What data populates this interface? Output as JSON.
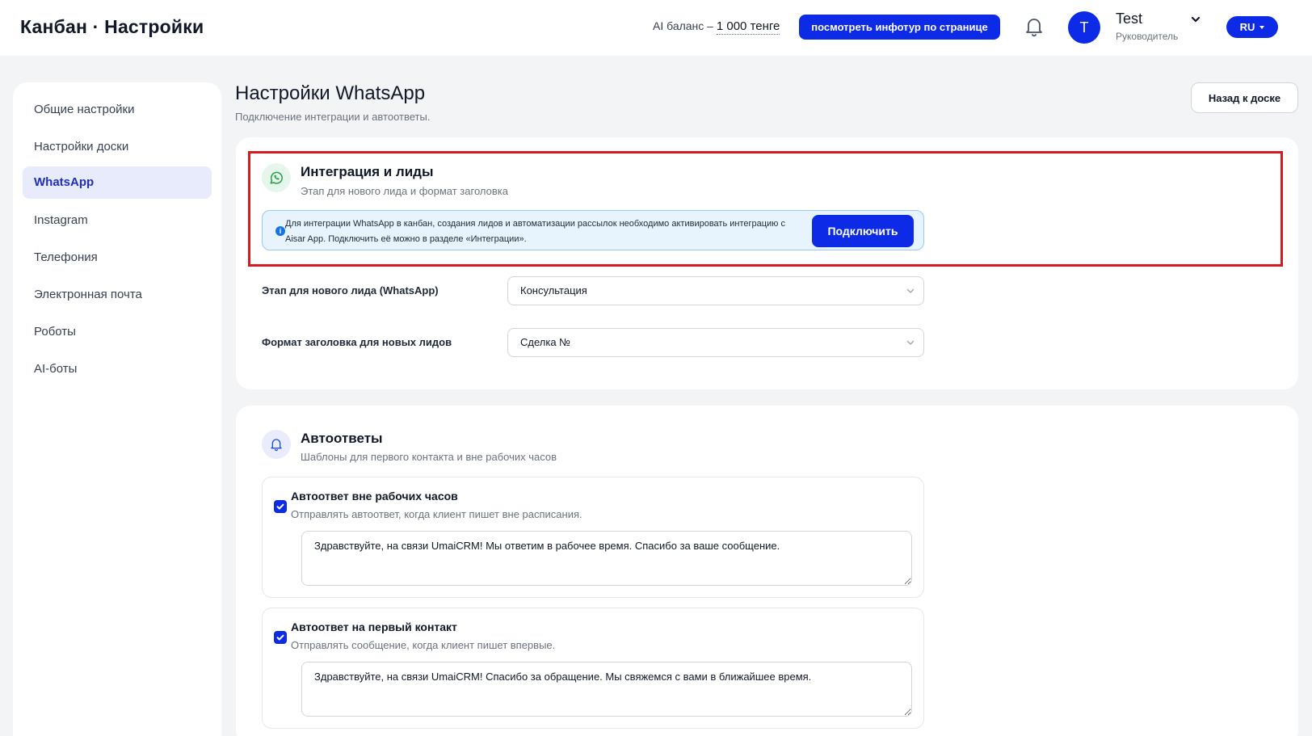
{
  "header": {
    "app_title": "Канбан · Настройки",
    "ai_balance_label": "AI баланс –",
    "ai_balance_amount": "1 000 тенге",
    "info_tour_label": "посмотреть инфотур по странице",
    "user": {
      "avatar_letter": "T",
      "name": "Test",
      "role": "Руководитель"
    },
    "language": "RU"
  },
  "sidebar": {
    "items": [
      {
        "label": "Общие настройки",
        "active": false
      },
      {
        "label": "Настройки доски",
        "active": false
      },
      {
        "label": "WhatsApp",
        "active": true
      },
      {
        "label": "Instagram",
        "active": false
      },
      {
        "label": "Телефония",
        "active": false
      },
      {
        "label": "Электронная почта",
        "active": false
      },
      {
        "label": "Роботы",
        "active": false
      },
      {
        "label": "AI-боты",
        "active": false
      }
    ]
  },
  "page": {
    "title": "Настройки WhatsApp",
    "subtitle": "Подключение интеграции и автоответы.",
    "back_label": "Назад к доске"
  },
  "integration": {
    "title": "Интеграция и лиды",
    "subtitle": "Этап для нового лида и формат заголовка",
    "info_text": "Для интеграции WhatsApp в канбан, создания лидов и автоматизации рассылок необходимо активировать интеграцию с Aisar App. Подключить её можно в разделе «Интеграции».",
    "connect_label": "Подключить",
    "stage_label": "Этап для нового лида (WhatsApp)",
    "stage_value": "Консультация",
    "title_format_label": "Формат заголовка для новых лидов",
    "title_format_value": "Сделка №"
  },
  "autoreplies": {
    "title": "Автоответы",
    "subtitle": "Шаблоны для первого контакта и вне рабочих часов",
    "items": [
      {
        "checked": true,
        "title": "Автоответ вне рабочих часов",
        "subtitle": "Отправлять автоответ, когда клиент пишет вне расписания.",
        "message": "Здравствуйте, на связи UmaiCRM! Мы ответим в рабочее время. Спасибо за ваше сообщение."
      },
      {
        "checked": true,
        "title": "Автоответ на первый контакт",
        "subtitle": "Отправлять сообщение, когда клиент пишет впервые.",
        "message": "Здравствуйте, на связи UmaiCRM! Спасибо за обращение. Мы свяжемся с вами в ближайшее время."
      }
    ]
  },
  "colors": {
    "primary": "#0d2be6",
    "highlight_border": "#d71920",
    "info_bg": "#e7f3fd",
    "whatsapp_green": "#25a244"
  }
}
